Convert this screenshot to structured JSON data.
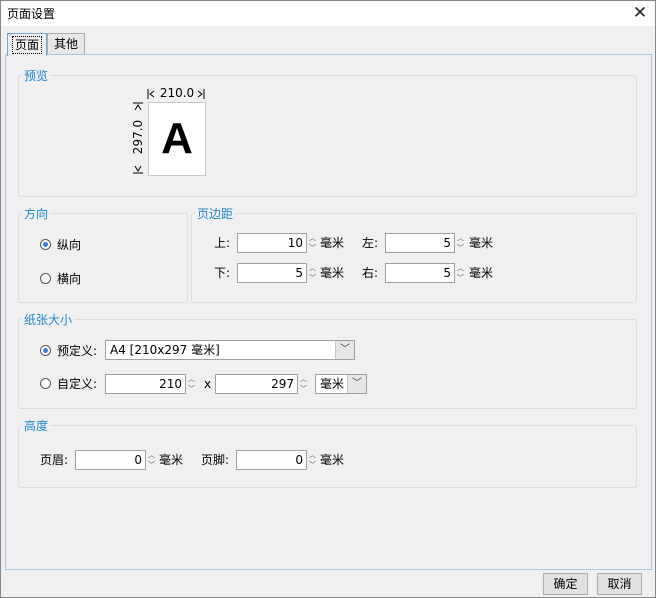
{
  "window": {
    "title": "页面设置",
    "close_symbol": "✕"
  },
  "tabs": [
    {
      "label": "页面"
    },
    {
      "label": "其他"
    }
  ],
  "preview": {
    "label": "预览",
    "width": "210.0",
    "height": "297.0",
    "letter": "A"
  },
  "orientation": {
    "label": "方向",
    "portrait": "纵向",
    "landscape": "横向",
    "selected": "纵向"
  },
  "margins": {
    "label": "页边距",
    "top": {
      "label": "上:",
      "value": "10"
    },
    "bottom": {
      "label": "下:",
      "value": "5"
    },
    "left": {
      "label": "左:",
      "value": "5"
    },
    "right": {
      "label": "右:",
      "value": "5"
    },
    "unit": "毫米"
  },
  "paper": {
    "label": "纸张大小",
    "predefined_label": "预定义:",
    "predefined_value": "A4 [210x297 毫米]",
    "custom_label": "自定义:",
    "custom_width": "210",
    "custom_x": "x",
    "custom_height": "297",
    "custom_unit": "毫米",
    "selected": "预定义"
  },
  "height": {
    "label": "高度",
    "header_label": "页眉:",
    "header_value": "0",
    "footer_label": "页脚:",
    "footer_value": "0",
    "unit": "毫米"
  },
  "buttons": {
    "ok": "确定",
    "cancel": "取消"
  }
}
